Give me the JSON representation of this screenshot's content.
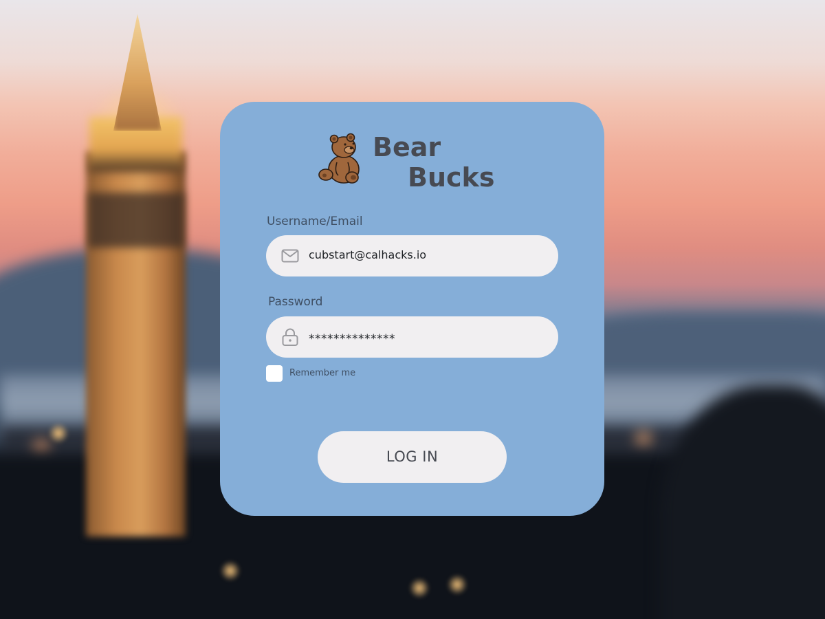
{
  "app": {
    "name_line1": "Bear",
    "name_line2": "Bucks",
    "logo": "bear-mascot-logo"
  },
  "login_form": {
    "username": {
      "label": "Username/Email",
      "value": "cubstart@calhacks.io",
      "icon": "envelope-icon"
    },
    "password": {
      "label": "Password",
      "masked_value": "**************",
      "icon": "lock-icon"
    },
    "remember_me": {
      "label": "Remember me",
      "checked": false
    },
    "submit_label": "LOG IN"
  },
  "colors": {
    "card_background": "#85aed8",
    "field_background": "#f1eff1",
    "brand_text": "#474a52",
    "label_text": "#3f4f63"
  }
}
